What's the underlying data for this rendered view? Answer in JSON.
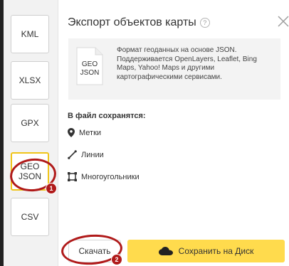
{
  "sidebar": {
    "formats": [
      {
        "label": "KML"
      },
      {
        "label": "XLSX"
      },
      {
        "label": "GPX"
      },
      {
        "label_line1": "GEO",
        "label_line2": "JSON",
        "selected": true
      },
      {
        "label": "CSV"
      }
    ]
  },
  "dialog": {
    "title": "Экспорт объектов карты",
    "help_icon": "?",
    "close_icon": "close-icon",
    "info": {
      "file_icon_line1": "GEO",
      "file_icon_line2": "JSON",
      "text": "Формат геоданных на основе JSON. Поддерживается OpenLayers, Leaflet, Bing Maps, Yahoo! Maps и другими картографическими сервисами."
    },
    "saves_heading": "В файл сохранятся:",
    "features": [
      {
        "icon": "placemark-icon",
        "label": "Метки"
      },
      {
        "icon": "line-icon",
        "label": "Линии"
      },
      {
        "icon": "polygon-icon",
        "label": "Многоугольники"
      }
    ]
  },
  "footer": {
    "download_label": "Скачать",
    "save_disk_label": "Сохранить на Диск",
    "disk_icon": "cloud-icon"
  },
  "annotations": {
    "badge_1": "1",
    "badge_2": "2"
  },
  "colors": {
    "accent_yellow": "#ffdb4d",
    "selected_border": "#f0c419",
    "annotation_red": "#b01a1a"
  }
}
